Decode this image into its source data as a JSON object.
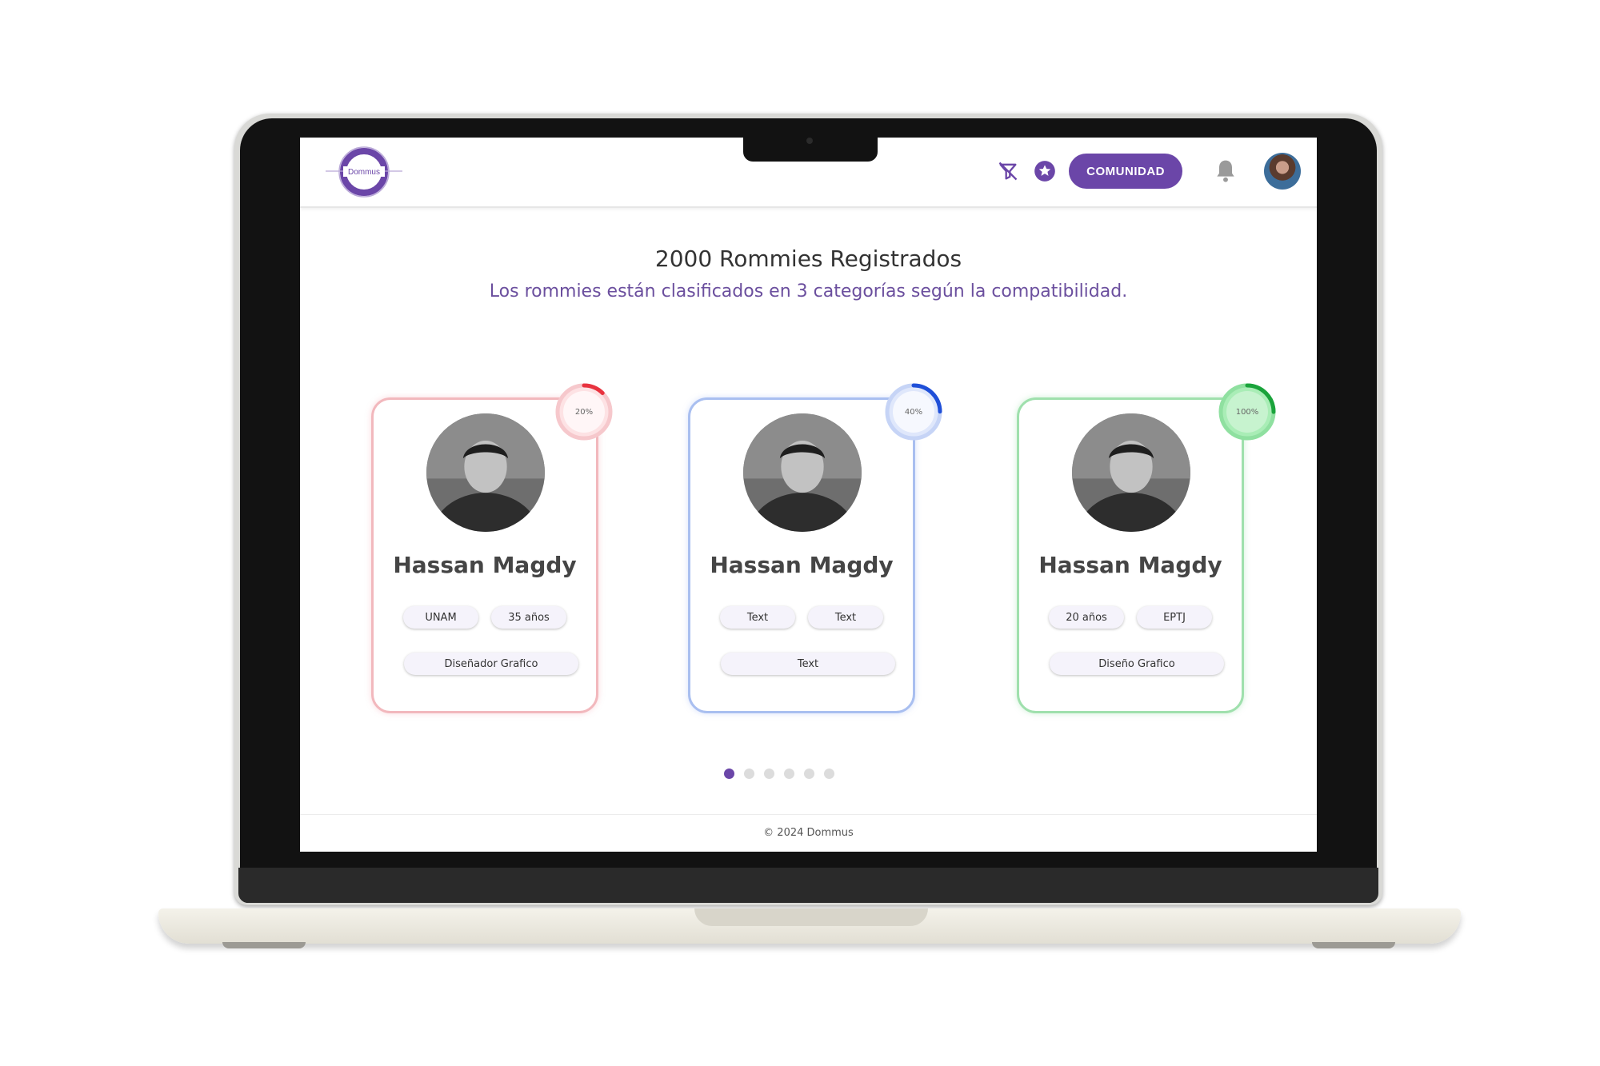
{
  "header": {
    "logo_text": "Dommus",
    "community_label": "COMUNIDAD",
    "icons": [
      "filter-off-icon",
      "star-badge-icon",
      "bell-icon",
      "user-avatar"
    ]
  },
  "hero": {
    "title": "2000 Rommies Registrados",
    "subtitle": "Los rommies están clasificados en 3 categorías según la compatibilidad."
  },
  "cards": [
    {
      "name": "Hassan Magdy",
      "compatibility": "20%",
      "compatibility_value": 0.2,
      "color": "#e8333f",
      "tags": [
        "UNAM",
        "35 años"
      ],
      "wide_tag": "Diseñador Grafico"
    },
    {
      "name": "Hassan Magdy",
      "compatibility": "40%",
      "compatibility_value": 0.4,
      "color": "#1f4fd8",
      "tags": [
        "Text",
        "Text"
      ],
      "wide_tag": "Text"
    },
    {
      "name": "Hassan Magdy",
      "compatibility": "100%",
      "compatibility_value": 1.0,
      "color": "#1aa33b",
      "tags": [
        "20 años",
        "EPTJ"
      ],
      "wide_tag": "Diseño Grafico"
    }
  ],
  "pagination": {
    "total": 6,
    "active": 0
  },
  "footer": {
    "text": "© 2024 Dommus"
  },
  "colors": {
    "accent": "#6b46a8",
    "text_dark": "#333333",
    "subtitle": "#6b4f9e"
  }
}
